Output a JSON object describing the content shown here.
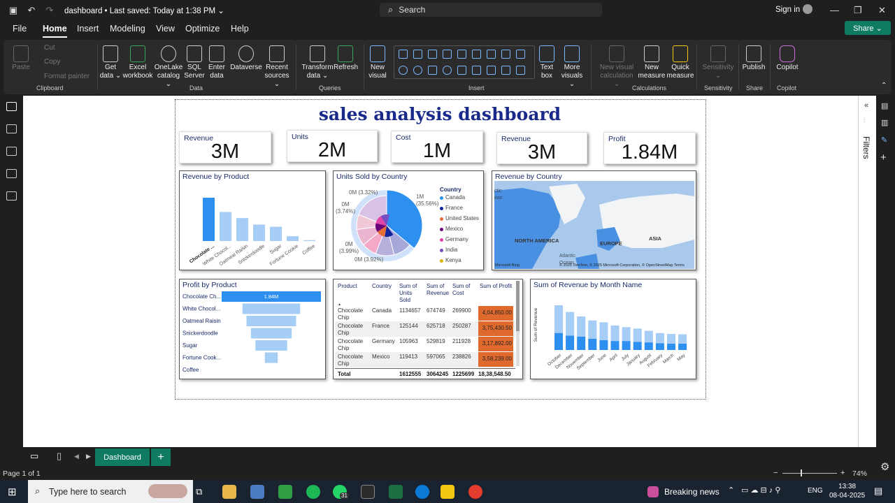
{
  "titlebar": {
    "doc_title": "dashboard • Last saved: Today at 1:38 PM ⌄",
    "search_placeholder": "Search",
    "signin": "Sign in"
  },
  "menu": {
    "items": [
      "File",
      "Home",
      "Insert",
      "Modeling",
      "View",
      "Optimize",
      "Help"
    ],
    "share": "Share ⌄"
  },
  "ribbon": {
    "clipboard": {
      "paste": "Paste",
      "cut": "Cut",
      "copy": "Copy",
      "format_painter": "Format painter",
      "label": "Clipboard"
    },
    "data": {
      "get_data": "Get data ⌄",
      "excel": "Excel workbook",
      "onelake": "OneLake catalog ⌄",
      "sql": "SQL Server",
      "enter": "Enter data",
      "dataverse": "Dataverse",
      "recent": "Recent sources ⌄",
      "label": "Data"
    },
    "queries": {
      "transform": "Transform data ⌄",
      "refresh": "Refresh",
      "label": "Queries"
    },
    "insert": {
      "new_visual": "New visual",
      "text_box": "Text box",
      "more_visuals": "More visuals ⌄",
      "label": "Insert"
    },
    "calculations": {
      "new_visual_calc": "New visual calculation ⌄",
      "new_measure": "New measure",
      "quick_measure": "Quick measure",
      "label": "Calculations"
    },
    "sensitivity": {
      "sensitivity": "Sensitivity ⌄",
      "label": "Sensitivity"
    },
    "share": {
      "publish": "Publish",
      "label": "Share"
    },
    "copilot": {
      "copilot": "Copilot",
      "label": "Copilot"
    }
  },
  "report": {
    "title": "sales analysis dashboard",
    "cards": [
      {
        "label": "Revenue",
        "value": "3M"
      },
      {
        "label": "Units",
        "value": "2M"
      },
      {
        "label": "Cost",
        "value": "1M"
      },
      {
        "label": "Revenue",
        "value": "3M"
      },
      {
        "label": "Profit",
        "value": "1.84M"
      }
    ],
    "revenue_by_product": {
      "title": "Revenue by Product",
      "categories": [
        "Chocolate ...",
        "White Chocol...",
        "Oatmeal Raisin",
        "Snickerdoodle",
        "Sugar",
        "Fortune Cookie",
        "Coffee"
      ],
      "values": [
        1.0,
        0.67,
        0.53,
        0.38,
        0.33,
        0.11,
        0.02
      ]
    },
    "units_by_country": {
      "title": "Units Sold by Country",
      "legend_title": "Country",
      "legend": [
        "Canada",
        "France",
        "United States",
        "Mexico",
        "Germany",
        "India",
        "Kenya"
      ],
      "legend_colors": [
        "#2d8ff0",
        "#12239e",
        "#e66c37",
        "#6b007b",
        "#e044a7",
        "#744ec2",
        "#d9b300"
      ],
      "labels": {
        "big": "1M\n(35.56%)",
        "l1": "0M (3.32%)",
        "l2": "0M\n(3.74%)",
        "l3": "0M\n(3.99%)",
        "l4": "0M (3.92%)"
      }
    },
    "revenue_by_country": {
      "title": "Revenue by Country",
      "map_labels": {
        "na": "NORTH AMERICA",
        "eu": "EUROPE",
        "asia": "ASIA",
        "atl": "Atlantic\nOcean",
        "arctic": "ctic\nean"
      },
      "copyright": "© 2025 TomTom, © 2025 Microsoft Corporation, © OpenStreetMap  Terms",
      "brand": "Microsoft Bing"
    },
    "profit_by_product": {
      "title": "Profit by Product",
      "categories": [
        "Chocolate Ch...",
        "White Chocol...",
        "Oatmeal Raisin",
        "Snickerdoodle",
        "Sugar",
        "Fortune Cook...",
        "Coffee"
      ],
      "values": [
        1.0,
        0.58,
        0.5,
        0.41,
        0.32,
        0.13,
        0.0
      ],
      "top_label": "1.84M"
    },
    "table": {
      "headers": [
        "Product",
        "Country",
        "Sum of Units Sold",
        "Sum of Revenue",
        "Sum of Cost",
        "Sum of Profit"
      ],
      "rows": [
        [
          "Chocolate Chip",
          "Canada",
          "1134657",
          "674749",
          "269900",
          "4,04,850.00"
        ],
        [
          "Chocolate Chip",
          "France",
          "125144",
          "625718",
          "250287",
          "3,75,430.50"
        ],
        [
          "Chocolate Chip",
          "Germany",
          "105963",
          "529819",
          "211928",
          "3,17,892.00"
        ],
        [
          "Chocolate Chip",
          "Mexico",
          "119413",
          "597065",
          "238826",
          "3,58,239.00"
        ]
      ],
      "total": [
        "Total",
        "",
        "1612555",
        "3064245",
        "1225699",
        "18,38,548.50"
      ]
    },
    "revenue_by_month": {
      "title": "Sum of Revenue by Month Name",
      "ylabel": "Sum of Revenue",
      "categories": [
        "October",
        "December",
        "November",
        "September",
        "June",
        "April",
        "July",
        "January",
        "August",
        "February",
        "March",
        "May"
      ],
      "light": [
        1.0,
        0.85,
        0.75,
        0.66,
        0.62,
        0.55,
        0.51,
        0.48,
        0.43,
        0.38,
        0.36,
        0.35
      ],
      "dark": [
        0.38,
        0.32,
        0.3,
        0.25,
        0.22,
        0.2,
        0.2,
        0.18,
        0.17,
        0.15,
        0.14,
        0.14
      ]
    }
  },
  "right_panel": {
    "filters": "Filters"
  },
  "pages": {
    "tab": "Dashboard",
    "add": "+"
  },
  "status": {
    "page": "Page 1 of 1",
    "zoom": "74%"
  },
  "taskbar": {
    "search": "Type here to search",
    "news": "Breaking news",
    "lang": "ENG",
    "time": "13:38",
    "date": "08-04-2025",
    "whatsapp_badge": "31"
  }
}
